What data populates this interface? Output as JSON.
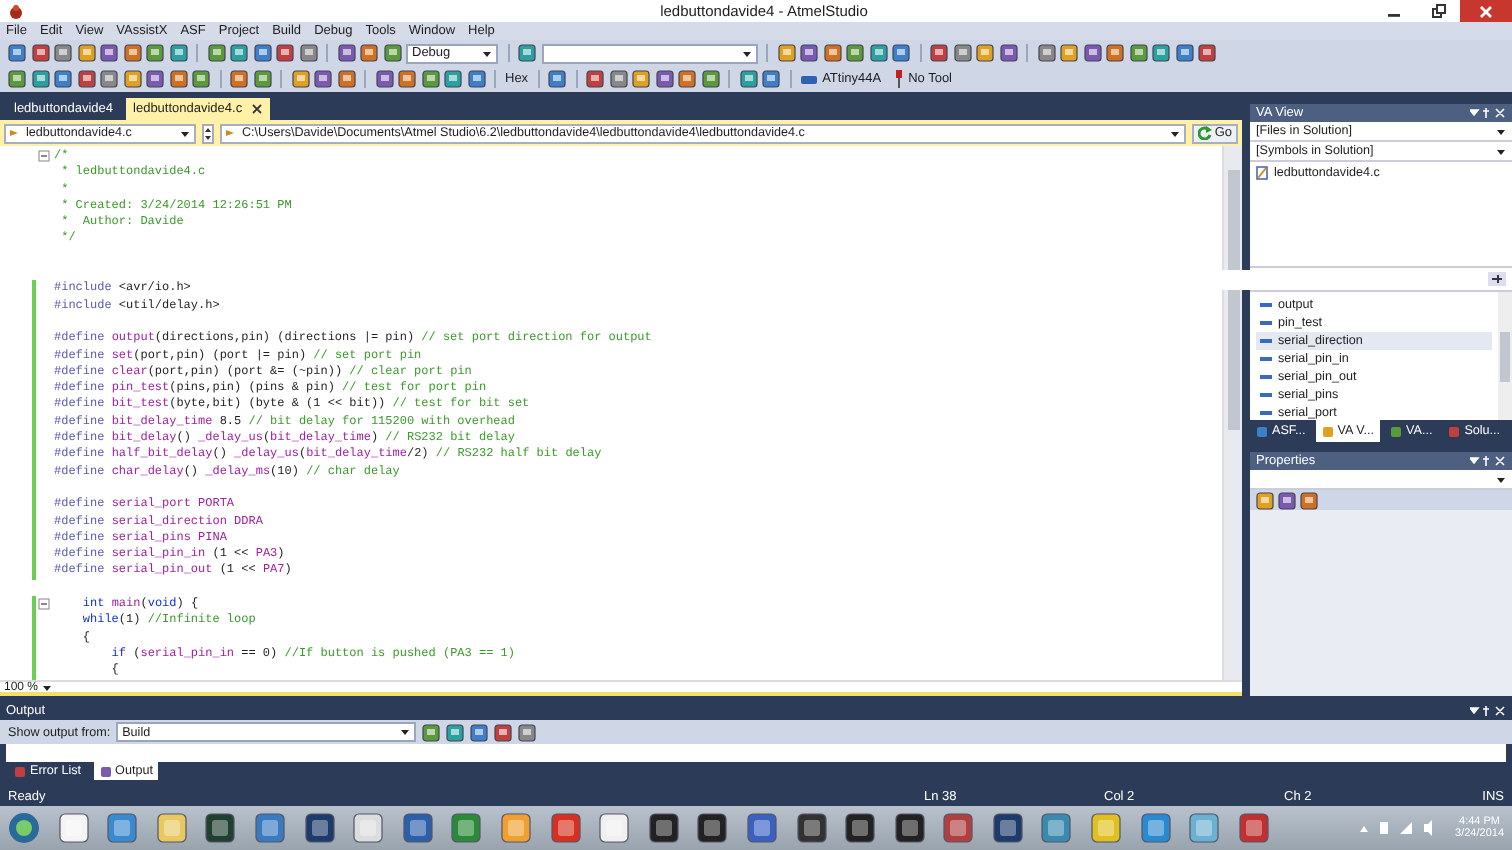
{
  "window": {
    "title": "ledbuttondavide4 - AtmelStudio"
  },
  "menu": [
    "File",
    "Edit",
    "View",
    "VAssistX",
    "ASF",
    "Project",
    "Build",
    "Debug",
    "Tools",
    "Window",
    "Help"
  ],
  "toolbar": {
    "configuration": "Debug",
    "hex": "Hex",
    "device": "ATtiny44A",
    "tool": "No Tool"
  },
  "document_tabs": [
    {
      "label": "ledbuttondavide4",
      "selected": false
    },
    {
      "label": "ledbuttondavide4.c",
      "selected": true
    }
  ],
  "navigation": {
    "scope": "ledbuttondavide4.c",
    "path": "C:\\Users\\Davide\\Documents\\Atmel Studio\\6.2\\ledbuttondavide4\\ledbuttondavide4\\ledbuttondavide4.c",
    "go": "Go"
  },
  "editor": {
    "zoom": "100 %",
    "lines": [
      {
        "changed": false,
        "fold": true,
        "segments": [
          {
            "kind": "comment",
            "text": "/*"
          }
        ]
      },
      {
        "changed": false,
        "fold": false,
        "segments": [
          {
            "kind": "comment",
            "text": " * ledbuttondavide4.c"
          }
        ]
      },
      {
        "changed": false,
        "fold": false,
        "segments": [
          {
            "kind": "comment",
            "text": " *"
          }
        ]
      },
      {
        "changed": false,
        "fold": false,
        "segments": [
          {
            "kind": "comment",
            "text": " * Created: 3/24/2014 12:26:51 PM"
          }
        ]
      },
      {
        "changed": false,
        "fold": false,
        "segments": [
          {
            "kind": "comment",
            "text": " *  Author: Davide"
          }
        ]
      },
      {
        "changed": false,
        "fold": false,
        "segments": [
          {
            "kind": "comment",
            "text": " */"
          }
        ]
      },
      {
        "changed": false,
        "fold": false
      },
      {
        "changed": false,
        "fold": false
      },
      {
        "changed": true,
        "fold": false,
        "segments": [
          {
            "kind": "directive",
            "text": "#include "
          },
          {
            "kind": "plain",
            "text": "<avr/io.h>"
          }
        ]
      },
      {
        "changed": true,
        "fold": false,
        "segments": [
          {
            "kind": "directive",
            "text": "#include "
          },
          {
            "kind": "plain",
            "text": "<util/delay.h>"
          }
        ]
      },
      {
        "changed": true,
        "fold": false
      },
      {
        "changed": true,
        "fold": false,
        "segments": [
          {
            "kind": "directive",
            "text": "#define "
          },
          {
            "kind": "macro",
            "text": "output"
          },
          {
            "kind": "plain",
            "text": "(directions,pin) (directions |= pin) "
          },
          {
            "kind": "comment",
            "text": "// set port direction for output"
          }
        ]
      },
      {
        "changed": true,
        "fold": false,
        "segments": [
          {
            "kind": "directive",
            "text": "#define "
          },
          {
            "kind": "macro",
            "text": "set"
          },
          {
            "kind": "plain",
            "text": "(port,pin) (port |= pin) "
          },
          {
            "kind": "comment",
            "text": "// set port pin"
          }
        ]
      },
      {
        "changed": true,
        "fold": false,
        "segments": [
          {
            "kind": "directive",
            "text": "#define "
          },
          {
            "kind": "macro",
            "text": "clear"
          },
          {
            "kind": "plain",
            "text": "(port,pin) (port &= (~pin)) "
          },
          {
            "kind": "comment",
            "text": "// clear port pin"
          }
        ]
      },
      {
        "changed": true,
        "fold": false,
        "segments": [
          {
            "kind": "directive",
            "text": "#define "
          },
          {
            "kind": "macro",
            "text": "pin_test"
          },
          {
            "kind": "plain",
            "text": "(pins,pin) (pins & pin) "
          },
          {
            "kind": "comment",
            "text": "// test for port pin"
          }
        ]
      },
      {
        "changed": true,
        "fold": false,
        "segments": [
          {
            "kind": "directive",
            "text": "#define "
          },
          {
            "kind": "macro",
            "text": "bit_test"
          },
          {
            "kind": "plain",
            "text": "(byte,bit) (byte & (1 << bit)) "
          },
          {
            "kind": "comment",
            "text": "// test for bit set"
          }
        ]
      },
      {
        "changed": true,
        "fold": false,
        "segments": [
          {
            "kind": "directive",
            "text": "#define "
          },
          {
            "kind": "macro",
            "text": "bit_delay_time"
          },
          {
            "kind": "plain",
            "text": " 8.5 "
          },
          {
            "kind": "comment",
            "text": "// bit delay for 115200 with overhead"
          }
        ]
      },
      {
        "changed": true,
        "fold": false,
        "segments": [
          {
            "kind": "directive",
            "text": "#define "
          },
          {
            "kind": "macro",
            "text": "bit_delay"
          },
          {
            "kind": "plain",
            "text": "() "
          },
          {
            "kind": "macro",
            "text": "_delay_us"
          },
          {
            "kind": "plain",
            "text": "("
          },
          {
            "kind": "macro",
            "text": "bit_delay_time"
          },
          {
            "kind": "plain",
            "text": ") "
          },
          {
            "kind": "comment",
            "text": "// RS232 bit delay"
          }
        ]
      },
      {
        "changed": true,
        "fold": false,
        "segments": [
          {
            "kind": "directive",
            "text": "#define "
          },
          {
            "kind": "macro",
            "text": "half_bit_delay"
          },
          {
            "kind": "plain",
            "text": "() "
          },
          {
            "kind": "macro",
            "text": "_delay_us"
          },
          {
            "kind": "plain",
            "text": "("
          },
          {
            "kind": "macro",
            "text": "bit_delay_time"
          },
          {
            "kind": "plain",
            "text": "/2) "
          },
          {
            "kind": "comment",
            "text": "// RS232 half bit delay"
          }
        ]
      },
      {
        "changed": true,
        "fold": false,
        "segments": [
          {
            "kind": "directive",
            "text": "#define "
          },
          {
            "kind": "macro",
            "text": "char_delay"
          },
          {
            "kind": "plain",
            "text": "() "
          },
          {
            "kind": "macro",
            "text": "_delay_ms"
          },
          {
            "kind": "plain",
            "text": "(10) "
          },
          {
            "kind": "comment",
            "text": "// char delay"
          }
        ]
      },
      {
        "changed": true,
        "fold": false
      },
      {
        "changed": true,
        "fold": false,
        "segments": [
          {
            "kind": "directive",
            "text": "#define "
          },
          {
            "kind": "macro",
            "text": "serial_port PORTA"
          }
        ]
      },
      {
        "changed": true,
        "fold": false,
        "segments": [
          {
            "kind": "directive",
            "text": "#define "
          },
          {
            "kind": "macro",
            "text": "serial_direction DDRA"
          }
        ]
      },
      {
        "changed": true,
        "fold": false,
        "segments": [
          {
            "kind": "directive",
            "text": "#define "
          },
          {
            "kind": "macro",
            "text": "serial_pins PINA"
          }
        ]
      },
      {
        "changed": true,
        "fold": false,
        "segments": [
          {
            "kind": "directive",
            "text": "#define "
          },
          {
            "kind": "macro",
            "text": "serial_pin_in"
          },
          {
            "kind": "plain",
            "text": " (1 << "
          },
          {
            "kind": "macro",
            "text": "PA3"
          },
          {
            "kind": "plain",
            "text": ")"
          }
        ]
      },
      {
        "changed": true,
        "fold": false,
        "segments": [
          {
            "kind": "directive",
            "text": "#define "
          },
          {
            "kind": "macro",
            "text": "serial_pin_out"
          },
          {
            "kind": "plain",
            "text": " (1 << "
          },
          {
            "kind": "macro",
            "text": "PA7"
          },
          {
            "kind": "plain",
            "text": ")"
          }
        ]
      },
      {
        "changed": false,
        "fold": false
      },
      {
        "changed": true,
        "fold": true,
        "segments": [
          {
            "kind": "keyword",
            "text": "    int"
          },
          {
            "kind": "macro",
            "text": " main"
          },
          {
            "kind": "plain",
            "text": "("
          },
          {
            "kind": "keyword",
            "text": "void"
          },
          {
            "kind": "plain",
            "text": ") {"
          }
        ]
      },
      {
        "changed": true,
        "fold": false,
        "segments": [
          {
            "kind": "keyword",
            "text": "    while"
          },
          {
            "kind": "plain",
            "text": "(1) "
          },
          {
            "kind": "comment",
            "text": "//Infinite loop"
          }
        ]
      },
      {
        "changed": true,
        "fold": false,
        "segments": [
          {
            "kind": "plain",
            "text": "    {"
          }
        ]
      },
      {
        "changed": true,
        "fold": false,
        "segments": [
          {
            "kind": "keyword",
            "text": "        if"
          },
          {
            "kind": "plain",
            "text": " ("
          },
          {
            "kind": "macro",
            "text": "serial_pin_in"
          },
          {
            "kind": "plain",
            "text": " == 0) "
          },
          {
            "kind": "comment",
            "text": "//If button is pushed (PA3 == 1)"
          }
        ]
      },
      {
        "changed": true,
        "fold": false,
        "segments": [
          {
            "kind": "plain",
            "text": "        {"
          }
        ]
      }
    ]
  },
  "va_view": {
    "title": "VA View",
    "files_filter": "[Files in Solution]",
    "symbols_filter": "[Symbols in Solution]",
    "files": [
      "ledbuttondavide4.c"
    ],
    "symbols": [
      {
        "label": "output",
        "selected": false
      },
      {
        "label": "pin_test",
        "selected": false
      },
      {
        "label": "serial_direction",
        "selected": true
      },
      {
        "label": "serial_pin_in",
        "selected": false
      },
      {
        "label": "serial_pin_out",
        "selected": false
      },
      {
        "label": "serial_pins",
        "selected": false
      },
      {
        "label": "serial_port",
        "selected": false
      }
    ],
    "tabs": [
      {
        "label": "ASF...",
        "selected": false
      },
      {
        "label": "VA V...",
        "selected": true
      },
      {
        "label": "VA...",
        "selected": false
      },
      {
        "label": "Solu...",
        "selected": false
      }
    ]
  },
  "properties": {
    "title": "Properties"
  },
  "output": {
    "title": "Output",
    "source_label": "Show output from:",
    "source": "Build",
    "tabs": [
      {
        "label": "Error List",
        "selected": false
      },
      {
        "label": "Output",
        "selected": true
      }
    ]
  },
  "status_bar": {
    "message": "Ready",
    "line": "Ln 38",
    "column": "Col 2",
    "char": "Ch 2",
    "mode": "INS"
  },
  "taskbar": {
    "time": "4:44 PM",
    "date": "3/24/2014"
  }
}
